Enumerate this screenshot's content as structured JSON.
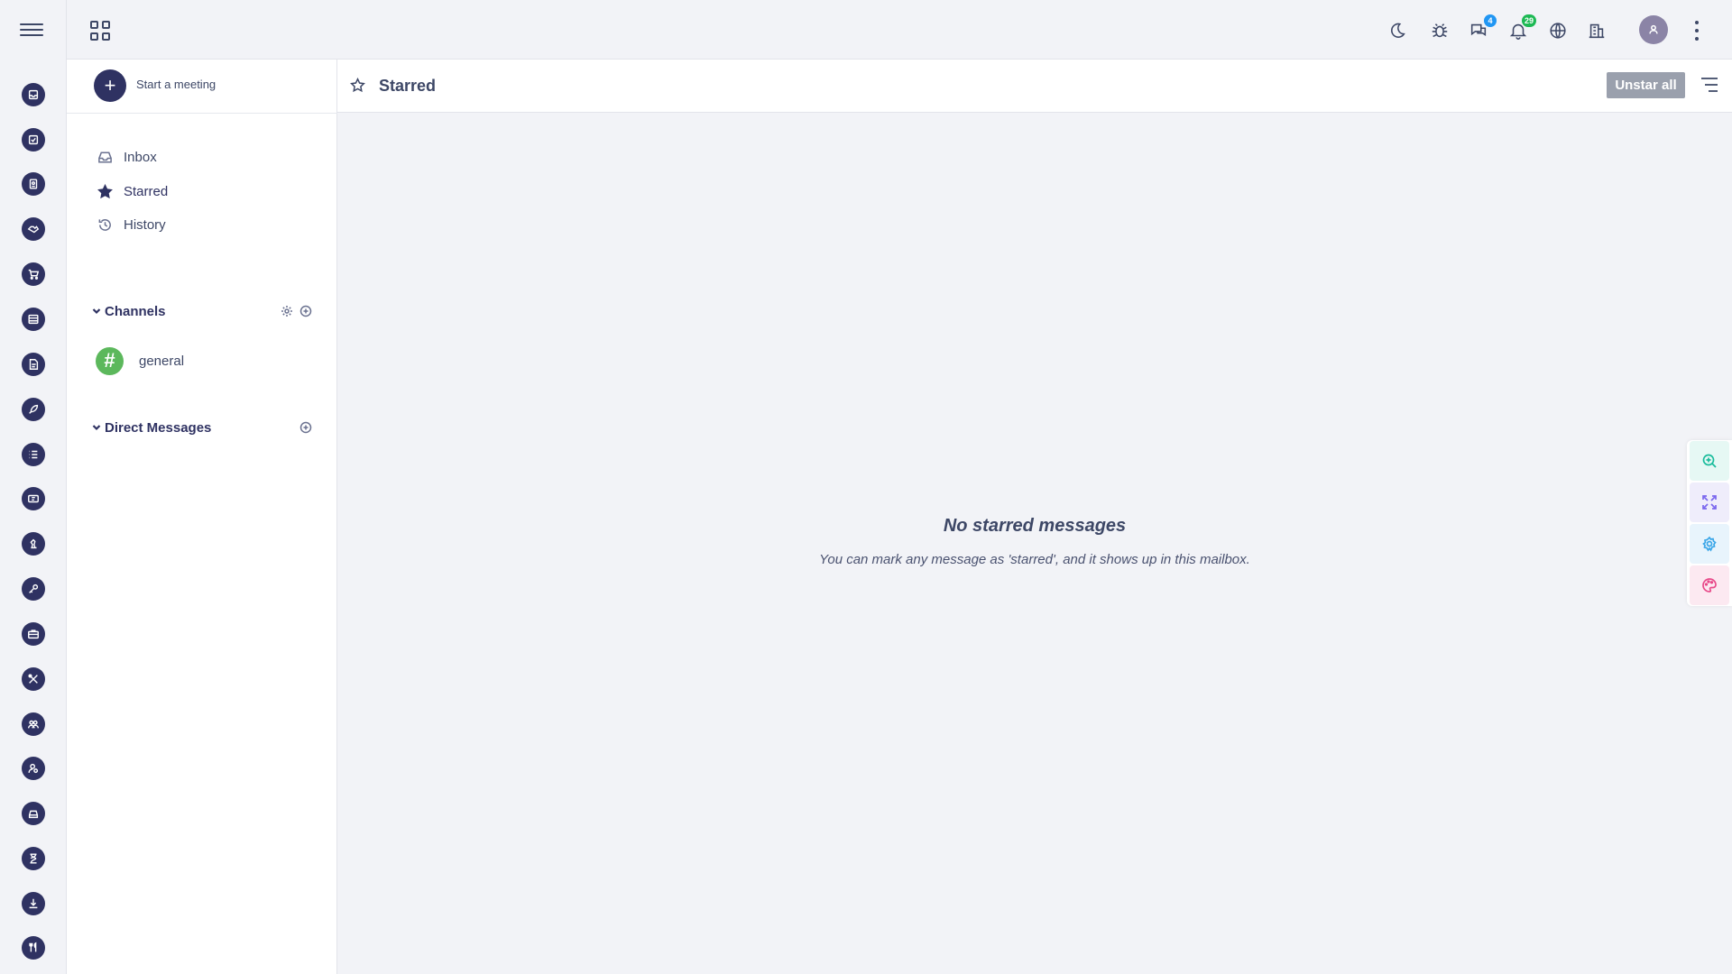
{
  "rail": {
    "menu_icon": "hamburger-icon",
    "items": [
      {
        "icon": "inbox-icon"
      },
      {
        "icon": "task-check-icon"
      },
      {
        "icon": "contact-icon"
      },
      {
        "icon": "handshake-icon"
      },
      {
        "icon": "cart-icon"
      },
      {
        "icon": "database-icon"
      },
      {
        "icon": "invoice-icon"
      },
      {
        "icon": "rocket-icon"
      },
      {
        "icon": "list-icon"
      },
      {
        "icon": "ticket-icon"
      },
      {
        "icon": "chess-icon"
      },
      {
        "icon": "key-icon"
      },
      {
        "icon": "briefcase-icon"
      },
      {
        "icon": "tools-icon"
      },
      {
        "icon": "team-icon"
      },
      {
        "icon": "user-settings-icon"
      },
      {
        "icon": "car-icon"
      },
      {
        "icon": "hourglass-icon"
      },
      {
        "icon": "download-icon"
      },
      {
        "icon": "restaurant-icon"
      }
    ]
  },
  "topbar": {
    "apps_icon": "apps-grid-icon",
    "icons": [
      {
        "name": "moon-icon"
      },
      {
        "name": "bug-icon"
      },
      {
        "name": "chat-icon",
        "badge": "4",
        "badge_color": "#2196f3"
      },
      {
        "name": "bell-icon",
        "badge": "29",
        "badge_color": "#1db954"
      },
      {
        "name": "globe-icon"
      },
      {
        "name": "building-icon"
      }
    ],
    "avatar_icon": "user-icon",
    "more_icon": "kebab-icon"
  },
  "sidebar": {
    "meeting_label": "Start a meeting",
    "nav": [
      {
        "label": "Inbox",
        "icon": "inbox-icon"
      },
      {
        "label": "Starred",
        "icon": "star-icon",
        "active": true
      },
      {
        "label": "History",
        "icon": "history-icon"
      }
    ],
    "channels": {
      "title": "Channels",
      "items": [
        {
          "label": "general",
          "avatar": "#"
        }
      ]
    },
    "direct_messages": {
      "title": "Direct Messages"
    }
  },
  "main": {
    "title": "Starred",
    "unstar_label": "Unstar all",
    "empty_title": "No starred messages",
    "empty_text": "You can mark any message as 'starred', and it shows up in this mailbox."
  },
  "floating": [
    {
      "icon": "zoom-in-icon",
      "color": "#1abc9c",
      "bg": "#e6f8f4"
    },
    {
      "icon": "expand-icon",
      "color": "#7b68ee",
      "bg": "#efedfb"
    },
    {
      "icon": "settings-icon",
      "color": "#3aa6e8",
      "bg": "#e8f4fc"
    },
    {
      "icon": "palette-icon",
      "color": "#e84a8a",
      "bg": "#fce9f1"
    }
  ],
  "colors": {
    "primary": "#2f3262",
    "text": "#3d4766",
    "background": "#f2f3f7",
    "channel_green": "#5cb85c",
    "button_gray": "#9aa0ad"
  }
}
